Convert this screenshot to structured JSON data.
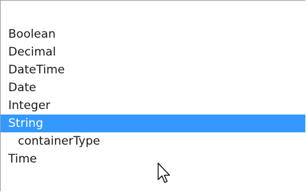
{
  "list": {
    "items": [
      {
        "label": "Boolean"
      },
      {
        "label": "Decimal"
      },
      {
        "label": "DateTime"
      },
      {
        "label": "Date"
      },
      {
        "label": "Integer"
      },
      {
        "label": "String",
        "selected": true
      },
      {
        "label": "containerType",
        "indented": true
      },
      {
        "label": "Time"
      }
    ]
  },
  "colors": {
    "selection": "#3399ff",
    "selected_text": "#ffffff",
    "text": "#1a1a1a",
    "border": "#a0a0a0"
  },
  "icons": {
    "cursor": "mouse-pointer-icon"
  }
}
